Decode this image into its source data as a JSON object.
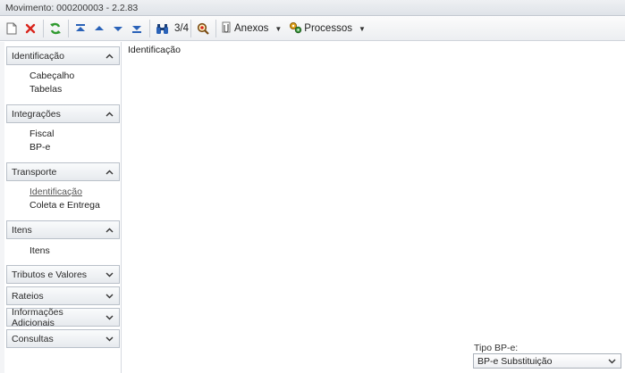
{
  "window": {
    "title": "Movimento: 000200003 - 2.2.83"
  },
  "toolbar": {
    "record_position": "3/4",
    "attachments_label": "Anexos",
    "processes_label": "Processos",
    "icons": [
      "new-document-icon",
      "delete-icon",
      "refresh-icon",
      "first-record-icon",
      "previous-record-icon",
      "next-record-icon",
      "last-record-icon",
      "binoculars-icon",
      "zoom-search-icon",
      "paperclip-icon",
      "gears-icon"
    ]
  },
  "sidebar": {
    "groups": [
      {
        "title": "Identificação",
        "expanded": true,
        "items": [
          "Cabeçalho",
          "Tabelas"
        ]
      },
      {
        "title": "Integrações",
        "expanded": true,
        "items": [
          "Fiscal",
          "BP-e"
        ]
      },
      {
        "title": "Transporte",
        "expanded": true,
        "items": [
          "Identificação",
          "Coleta e Entrega"
        ],
        "active_item": "Identificação"
      },
      {
        "title": "Itens",
        "expanded": true,
        "items": [
          "Itens"
        ]
      },
      {
        "title": "Tributos e Valores",
        "expanded": false,
        "items": []
      },
      {
        "title": "Rateios",
        "expanded": false,
        "items": []
      },
      {
        "title": "Informações Adicionais",
        "expanded": false,
        "items": []
      },
      {
        "title": "Consultas",
        "expanded": false,
        "items": []
      }
    ]
  },
  "main": {
    "section_title": "Identificação",
    "tipo_bpe": {
      "label": "Tipo BP-e:",
      "value": "BP-e Substituição"
    }
  },
  "colors": {
    "accent_green": "#2f9a2f",
    "delete_red": "#d9251d",
    "nav_blue": "#2a62b8"
  }
}
